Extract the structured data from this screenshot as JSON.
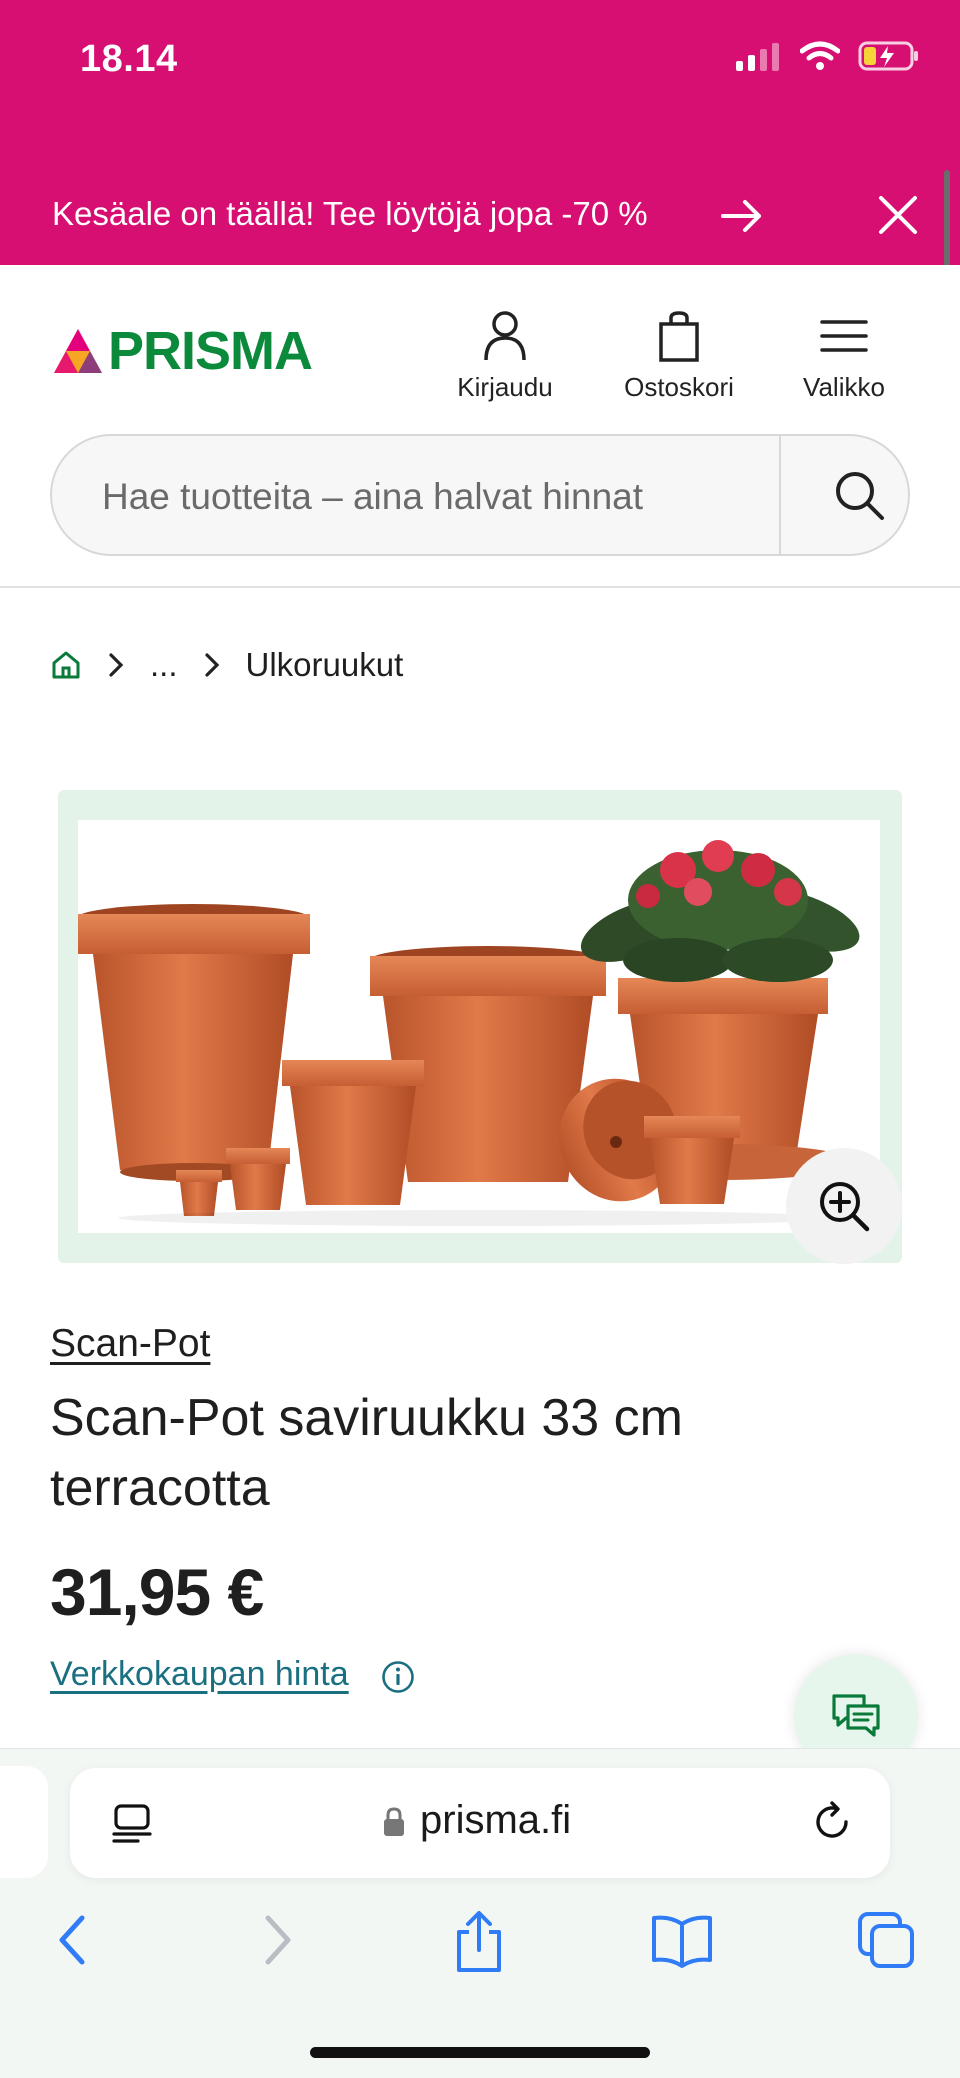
{
  "status_bar": {
    "time": "18.14"
  },
  "promo_banner": {
    "text": "Kesäale on täällä!  Tee löytöjä jopa -70 %"
  },
  "header": {
    "logo_text": "PRISMA",
    "nav": [
      {
        "label": "Kirjaudu",
        "icon": "user-icon"
      },
      {
        "label": "Ostoskori",
        "icon": "shopping-bag-icon"
      },
      {
        "label": "Valikko",
        "icon": "menu-icon"
      }
    ]
  },
  "search": {
    "placeholder": "Hae tuotteita – aina halvat hinnat"
  },
  "breadcrumb": {
    "ellipsis": "...",
    "current": "Ulkoruukut"
  },
  "product": {
    "brand": "Scan-Pot",
    "title": "Scan-Pot saviruukku 33 cm terracotta",
    "price": "31,95 €",
    "price_note": "Verkkokaupan hinta"
  },
  "browser": {
    "url": "prisma.fi"
  },
  "colors": {
    "banner": "#d80f72",
    "brand_green": "#0a8a3a",
    "link_teal": "#1a6f80",
    "terracotta": "#cf6a3d",
    "safari_blue": "#2f7cf6"
  }
}
